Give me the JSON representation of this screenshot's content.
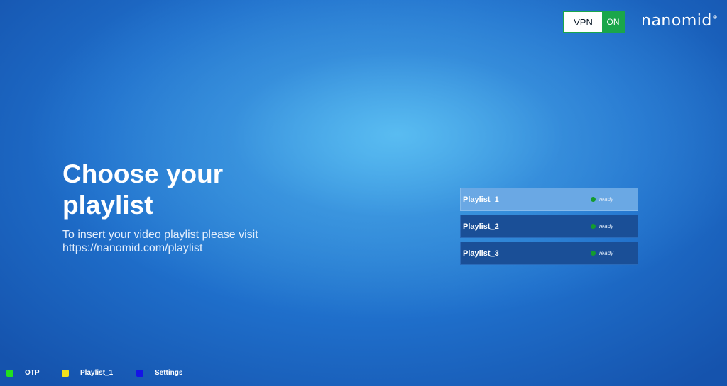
{
  "vpn": {
    "label": "VPN",
    "state": "ON",
    "color": "#1aa64a"
  },
  "logo": {
    "text": "nanomid",
    "reg": "®"
  },
  "hero": {
    "title": "Choose your playlist",
    "subtitle_line1": "To insert your video playlist please visit",
    "subtitle_line2": "https://nanomid.com/playlist"
  },
  "playlists": [
    {
      "name": "Playlist_1",
      "status": "ready",
      "selected": true
    },
    {
      "name": "Playlist_2",
      "status": "ready",
      "selected": false
    },
    {
      "name": "Playlist_3",
      "status": "ready",
      "selected": false
    }
  ],
  "legend": [
    {
      "label": "OTP",
      "color": "#22e01f",
      "icon": "green-key-icon"
    },
    {
      "label": "Playlist_1",
      "color": "#f2e21c",
      "icon": "yellow-key-icon"
    },
    {
      "label": "Settings",
      "color": "#1414e6",
      "icon": "blue-key-icon"
    }
  ],
  "colors": {
    "status_dot": "#149c2e",
    "selected_item": "#6aa8e4",
    "item": "#1a4f97"
  }
}
